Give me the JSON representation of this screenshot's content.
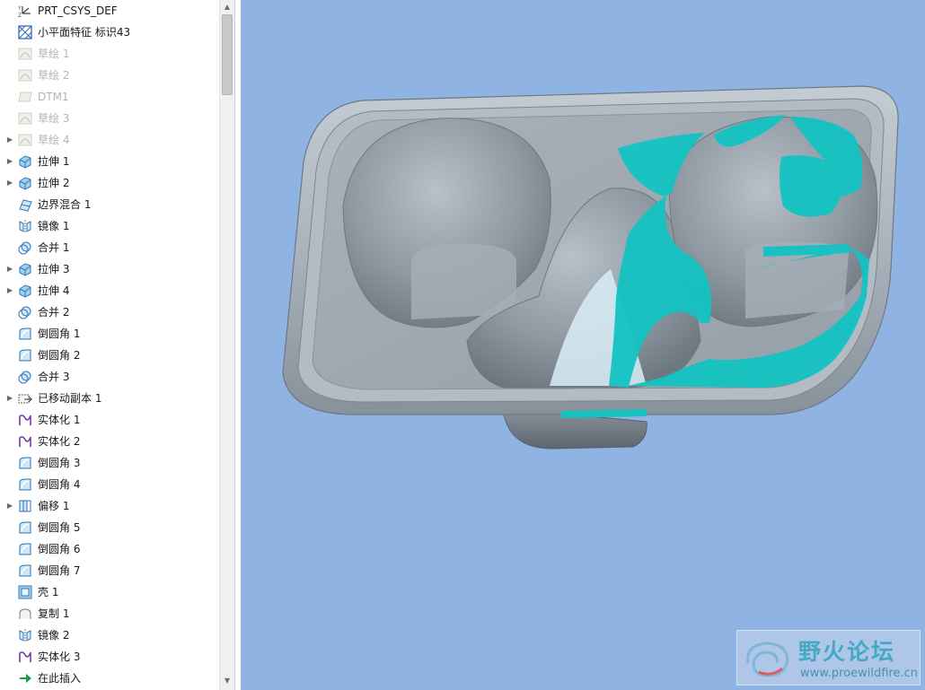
{
  "model_tree": {
    "items": [
      {
        "label": "PRT_CSYS_DEF",
        "icon": "csys-icon",
        "expandable": false,
        "suppressed": false
      },
      {
        "label": "小平面特征 标识43",
        "icon": "facet-feature-icon",
        "expandable": false,
        "suppressed": false
      },
      {
        "label": "草绘 1",
        "icon": "sketch-icon",
        "expandable": false,
        "suppressed": true
      },
      {
        "label": "草绘 2",
        "icon": "sketch-icon",
        "expandable": false,
        "suppressed": true
      },
      {
        "label": "DTM1",
        "icon": "datum-plane-icon",
        "expandable": false,
        "suppressed": true
      },
      {
        "label": "草绘 3",
        "icon": "sketch-icon",
        "expandable": false,
        "suppressed": true
      },
      {
        "label": "草绘 4",
        "icon": "sketch-icon",
        "expandable": true,
        "suppressed": true
      },
      {
        "label": "拉伸 1",
        "icon": "extrude-icon",
        "expandable": true,
        "suppressed": false
      },
      {
        "label": "拉伸 2",
        "icon": "extrude-icon",
        "expandable": true,
        "suppressed": false
      },
      {
        "label": "边界混合 1",
        "icon": "boundary-blend-icon",
        "expandable": false,
        "suppressed": false
      },
      {
        "label": "镜像 1",
        "icon": "mirror-icon",
        "expandable": false,
        "suppressed": false
      },
      {
        "label": "合并 1",
        "icon": "merge-icon",
        "expandable": false,
        "suppressed": false
      },
      {
        "label": "拉伸 3",
        "icon": "extrude-icon",
        "expandable": true,
        "suppressed": false
      },
      {
        "label": "拉伸 4",
        "icon": "extrude-icon",
        "expandable": true,
        "suppressed": false
      },
      {
        "label": "合并 2",
        "icon": "merge-icon",
        "expandable": false,
        "suppressed": false
      },
      {
        "label": "倒圆角 1",
        "icon": "round-icon",
        "expandable": false,
        "suppressed": false
      },
      {
        "label": "倒圆角 2",
        "icon": "round-icon",
        "expandable": false,
        "suppressed": false
      },
      {
        "label": "合并 3",
        "icon": "merge-icon",
        "expandable": false,
        "suppressed": false
      },
      {
        "label": "已移动副本 1",
        "icon": "moved-copy-icon",
        "expandable": true,
        "suppressed": false
      },
      {
        "label": "实体化 1",
        "icon": "solidify-icon",
        "expandable": false,
        "suppressed": false
      },
      {
        "label": "实体化 2",
        "icon": "solidify-icon",
        "expandable": false,
        "suppressed": false
      },
      {
        "label": "倒圆角 3",
        "icon": "round-icon",
        "expandable": false,
        "suppressed": false
      },
      {
        "label": "倒圆角 4",
        "icon": "round-icon",
        "expandable": false,
        "suppressed": false
      },
      {
        "label": "偏移 1",
        "icon": "offset-icon",
        "expandable": true,
        "suppressed": false
      },
      {
        "label": "倒圆角 5",
        "icon": "round-icon",
        "expandable": false,
        "suppressed": false
      },
      {
        "label": "倒圆角 6",
        "icon": "round-icon",
        "expandable": false,
        "suppressed": false
      },
      {
        "label": "倒圆角 7",
        "icon": "round-icon",
        "expandable": false,
        "suppressed": false
      },
      {
        "label": "壳 1",
        "icon": "shell-icon",
        "expandable": false,
        "suppressed": false
      },
      {
        "label": "复制 1",
        "icon": "copy-icon",
        "expandable": false,
        "suppressed": false
      },
      {
        "label": "镜像 2",
        "icon": "mirror-icon",
        "expandable": false,
        "suppressed": false
      },
      {
        "label": "实体化 3",
        "icon": "solidify-icon",
        "expandable": false,
        "suppressed": false
      },
      {
        "label": "在此插入",
        "icon": "insert-here-arrow-icon",
        "expandable": false,
        "suppressed": false
      }
    ]
  },
  "viewport": {
    "background_color": "#8fb3e3",
    "model_color": "#9ea8b1",
    "highlight_color": "#14c3c3"
  },
  "watermark": {
    "title": "野火论坛",
    "url": "www.proewildfire.cn"
  }
}
